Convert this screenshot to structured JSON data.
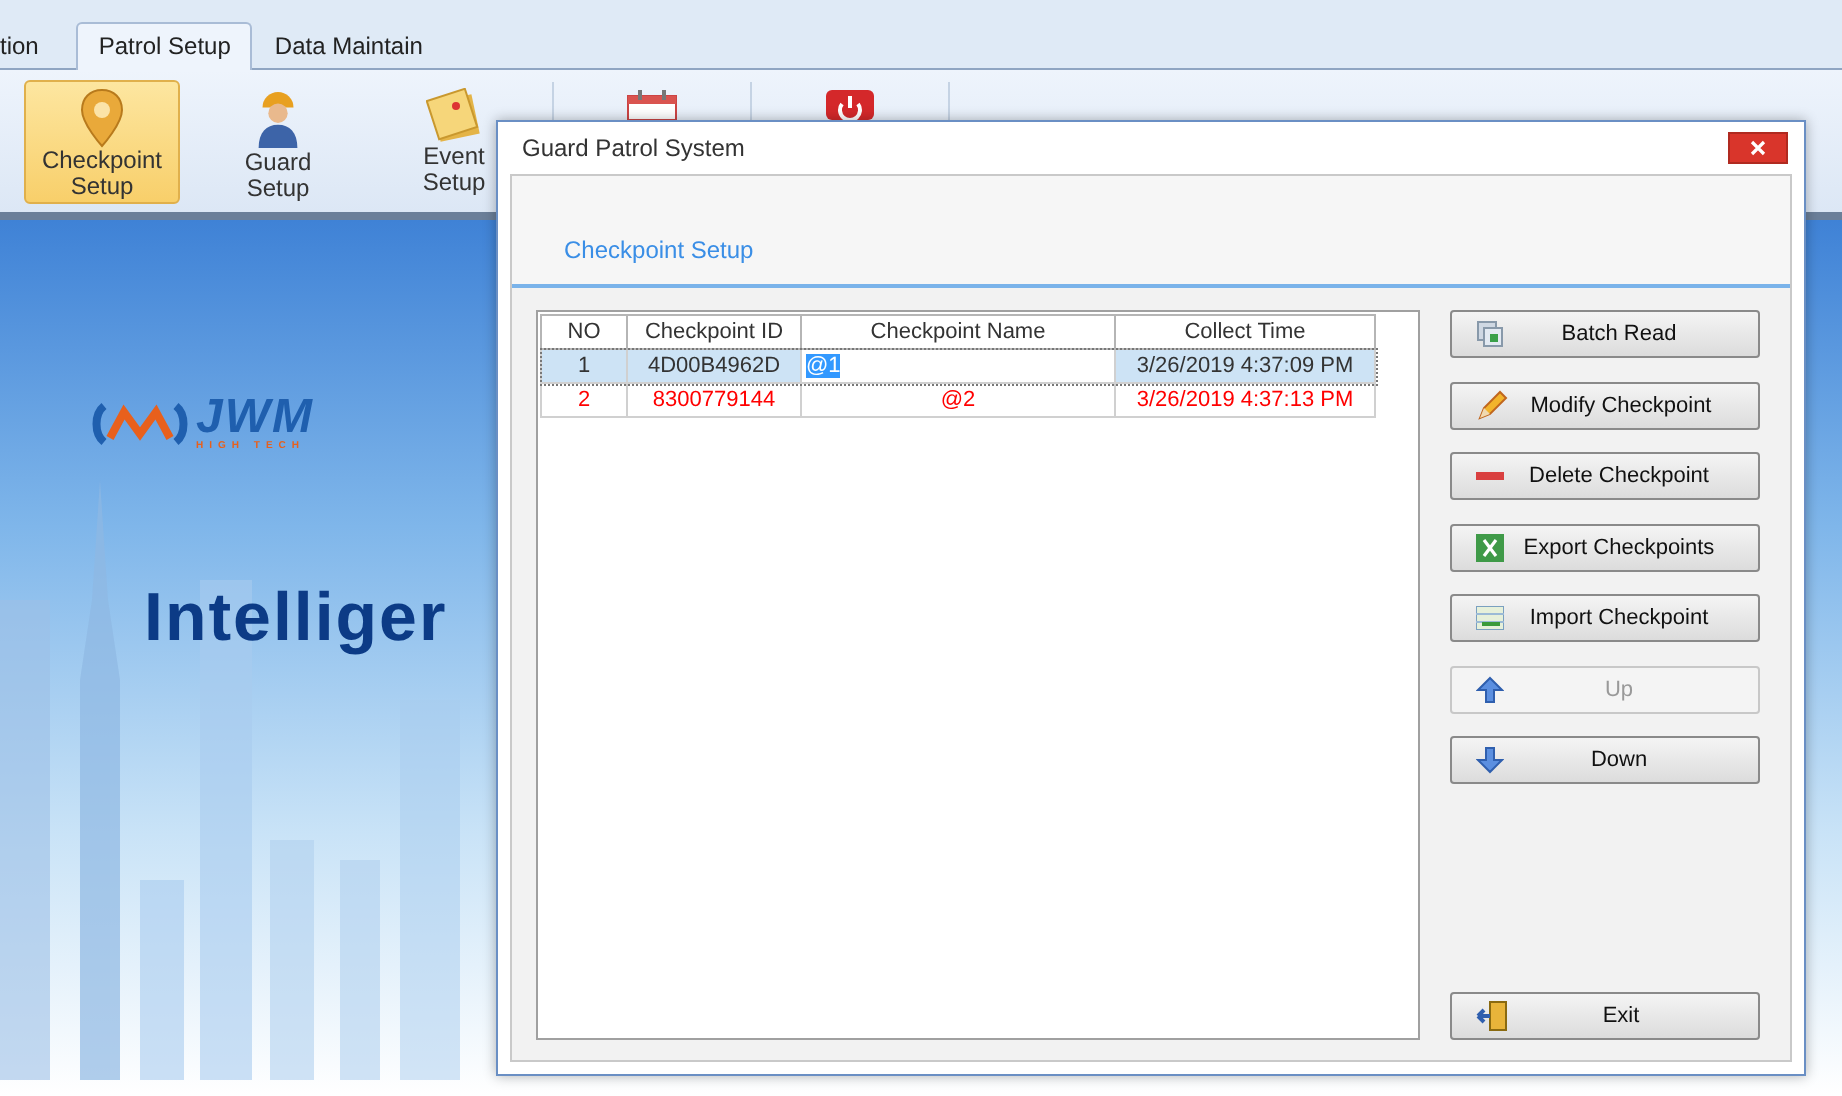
{
  "tabs": [
    {
      "label": "tion",
      "selected": false
    },
    {
      "label": "Patrol Setup",
      "selected": true
    },
    {
      "label": "Data Maintain",
      "selected": false
    }
  ],
  "ribbon": [
    {
      "kind": "pin",
      "lines": [
        "Checkpoint",
        "Setup"
      ],
      "selected": true
    },
    {
      "kind": "worker",
      "lines": [
        "Guard",
        "Setup"
      ],
      "selected": false
    },
    {
      "kind": "notes",
      "lines": [
        "Event",
        "Setup"
      ],
      "selected": false
    },
    {
      "kind": "calendar",
      "selected": false
    },
    {
      "kind": "power",
      "selected": false
    }
  ],
  "banner": {
    "logo": {
      "name": "JWM",
      "tagline": "HIGH TECH"
    },
    "headline": "Intelliger"
  },
  "dialog": {
    "title": "Guard Patrol System",
    "heading": "Checkpoint Setup",
    "table": {
      "columns": [
        "NO",
        "Checkpoint ID",
        "Checkpoint Name",
        "Collect Time"
      ],
      "rows": [
        {
          "no": "1",
          "id": "4D00B4962D",
          "name": "@1",
          "time": "3/26/2019 4:37:09 PM",
          "selected": true,
          "editing": true,
          "color": "#333333"
        },
        {
          "no": "2",
          "id": "8300779144",
          "name": "@2",
          "time": "3/26/2019 4:37:13 PM",
          "selected": false,
          "editing": false,
          "color": "#ff0000"
        }
      ]
    },
    "buttons": [
      {
        "kind": "batch",
        "label": "Batch Read",
        "disabled": false
      },
      {
        "kind": "pencil",
        "label": "Modify Checkpoint",
        "disabled": false
      },
      {
        "kind": "minus",
        "label": "Delete Checkpoint",
        "disabled": false
      },
      {
        "kind": "excel",
        "label": "Export Checkpoints",
        "disabled": false
      },
      {
        "kind": "import",
        "label": "Import Checkpoint",
        "disabled": false
      },
      {
        "kind": "up",
        "label": "Up",
        "disabled": true
      },
      {
        "kind": "down",
        "label": "Down",
        "disabled": false
      }
    ],
    "exit_button": {
      "kind": "exit",
      "label": "Exit",
      "disabled": false
    }
  }
}
